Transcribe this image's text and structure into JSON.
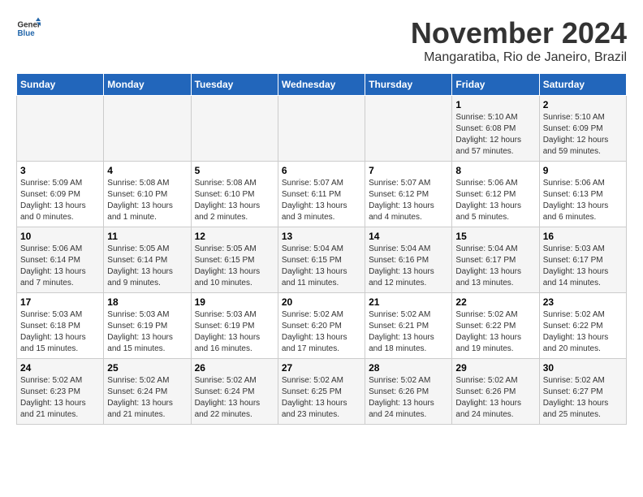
{
  "logo": {
    "general": "General",
    "blue": "Blue"
  },
  "header": {
    "month": "November 2024",
    "location": "Mangaratiba, Rio de Janeiro, Brazil"
  },
  "weekdays": [
    "Sunday",
    "Monday",
    "Tuesday",
    "Wednesday",
    "Thursday",
    "Friday",
    "Saturday"
  ],
  "weeks": [
    [
      {
        "day": "",
        "info": ""
      },
      {
        "day": "",
        "info": ""
      },
      {
        "day": "",
        "info": ""
      },
      {
        "day": "",
        "info": ""
      },
      {
        "day": "",
        "info": ""
      },
      {
        "day": "1",
        "info": "Sunrise: 5:10 AM\nSunset: 6:08 PM\nDaylight: 12 hours and 57 minutes."
      },
      {
        "day": "2",
        "info": "Sunrise: 5:10 AM\nSunset: 6:09 PM\nDaylight: 12 hours and 59 minutes."
      }
    ],
    [
      {
        "day": "3",
        "info": "Sunrise: 5:09 AM\nSunset: 6:09 PM\nDaylight: 13 hours and 0 minutes."
      },
      {
        "day": "4",
        "info": "Sunrise: 5:08 AM\nSunset: 6:10 PM\nDaylight: 13 hours and 1 minute."
      },
      {
        "day": "5",
        "info": "Sunrise: 5:08 AM\nSunset: 6:10 PM\nDaylight: 13 hours and 2 minutes."
      },
      {
        "day": "6",
        "info": "Sunrise: 5:07 AM\nSunset: 6:11 PM\nDaylight: 13 hours and 3 minutes."
      },
      {
        "day": "7",
        "info": "Sunrise: 5:07 AM\nSunset: 6:12 PM\nDaylight: 13 hours and 4 minutes."
      },
      {
        "day": "8",
        "info": "Sunrise: 5:06 AM\nSunset: 6:12 PM\nDaylight: 13 hours and 5 minutes."
      },
      {
        "day": "9",
        "info": "Sunrise: 5:06 AM\nSunset: 6:13 PM\nDaylight: 13 hours and 6 minutes."
      }
    ],
    [
      {
        "day": "10",
        "info": "Sunrise: 5:06 AM\nSunset: 6:14 PM\nDaylight: 13 hours and 7 minutes."
      },
      {
        "day": "11",
        "info": "Sunrise: 5:05 AM\nSunset: 6:14 PM\nDaylight: 13 hours and 9 minutes."
      },
      {
        "day": "12",
        "info": "Sunrise: 5:05 AM\nSunset: 6:15 PM\nDaylight: 13 hours and 10 minutes."
      },
      {
        "day": "13",
        "info": "Sunrise: 5:04 AM\nSunset: 6:15 PM\nDaylight: 13 hours and 11 minutes."
      },
      {
        "day": "14",
        "info": "Sunrise: 5:04 AM\nSunset: 6:16 PM\nDaylight: 13 hours and 12 minutes."
      },
      {
        "day": "15",
        "info": "Sunrise: 5:04 AM\nSunset: 6:17 PM\nDaylight: 13 hours and 13 minutes."
      },
      {
        "day": "16",
        "info": "Sunrise: 5:03 AM\nSunset: 6:17 PM\nDaylight: 13 hours and 14 minutes."
      }
    ],
    [
      {
        "day": "17",
        "info": "Sunrise: 5:03 AM\nSunset: 6:18 PM\nDaylight: 13 hours and 15 minutes."
      },
      {
        "day": "18",
        "info": "Sunrise: 5:03 AM\nSunset: 6:19 PM\nDaylight: 13 hours and 15 minutes."
      },
      {
        "day": "19",
        "info": "Sunrise: 5:03 AM\nSunset: 6:19 PM\nDaylight: 13 hours and 16 minutes."
      },
      {
        "day": "20",
        "info": "Sunrise: 5:02 AM\nSunset: 6:20 PM\nDaylight: 13 hours and 17 minutes."
      },
      {
        "day": "21",
        "info": "Sunrise: 5:02 AM\nSunset: 6:21 PM\nDaylight: 13 hours and 18 minutes."
      },
      {
        "day": "22",
        "info": "Sunrise: 5:02 AM\nSunset: 6:22 PM\nDaylight: 13 hours and 19 minutes."
      },
      {
        "day": "23",
        "info": "Sunrise: 5:02 AM\nSunset: 6:22 PM\nDaylight: 13 hours and 20 minutes."
      }
    ],
    [
      {
        "day": "24",
        "info": "Sunrise: 5:02 AM\nSunset: 6:23 PM\nDaylight: 13 hours and 21 minutes."
      },
      {
        "day": "25",
        "info": "Sunrise: 5:02 AM\nSunset: 6:24 PM\nDaylight: 13 hours and 21 minutes."
      },
      {
        "day": "26",
        "info": "Sunrise: 5:02 AM\nSunset: 6:24 PM\nDaylight: 13 hours and 22 minutes."
      },
      {
        "day": "27",
        "info": "Sunrise: 5:02 AM\nSunset: 6:25 PM\nDaylight: 13 hours and 23 minutes."
      },
      {
        "day": "28",
        "info": "Sunrise: 5:02 AM\nSunset: 6:26 PM\nDaylight: 13 hours and 24 minutes."
      },
      {
        "day": "29",
        "info": "Sunrise: 5:02 AM\nSunset: 6:26 PM\nDaylight: 13 hours and 24 minutes."
      },
      {
        "day": "30",
        "info": "Sunrise: 5:02 AM\nSunset: 6:27 PM\nDaylight: 13 hours and 25 minutes."
      }
    ]
  ]
}
